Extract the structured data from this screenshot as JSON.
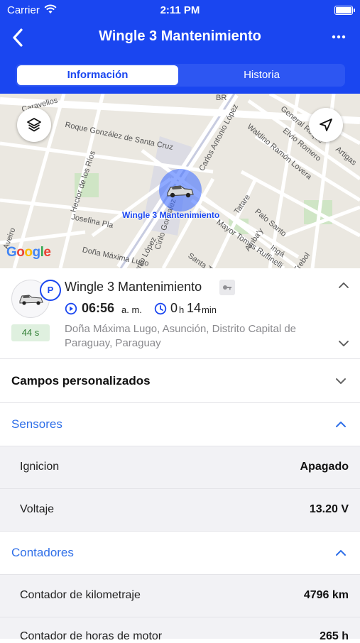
{
  "status": {
    "carrier": "Carrier",
    "time": "2:11 PM"
  },
  "nav": {
    "title": "Wingle 3 Mantenimiento"
  },
  "tabs": [
    {
      "label": "Información"
    },
    {
      "label": "Historia"
    }
  ],
  "map": {
    "marker_label": "Wingle 3 Mantenimiento",
    "google": "Google",
    "streets": [
      "Roque González de Santa Cruz",
      "Carlos Antonio López",
      "Doña Máxima Lugo",
      "Josefina Pla",
      "Hector de los Ríos",
      "Cirilo Gonzalez",
      "Waldino Ramón Lovera",
      "Elvio Romero",
      "General Roque",
      "Artigas",
      "Mayor Tomas Ruffinelli",
      "Santa Teresa",
      "Amba'y",
      "Ingá",
      "Trebol",
      "Palo Santo",
      "Antonio López",
      "Caravellos",
      "Aveiro",
      "Tatare",
      "BR"
    ]
  },
  "vehicle": {
    "name": "Wingle 3 Mantenimiento",
    "parking_badge": "P",
    "age": "44 s",
    "time": "06:56",
    "time_suffix": "a. m.",
    "duration_h": "0",
    "duration_h_unit": "h",
    "duration_m": "14",
    "duration_m_unit": "min",
    "address": "Doña Máxima Lugo, Asunción, Distrito Capital de Paraguay, Paraguay"
  },
  "sections": {
    "custom_fields": "Campos personalizados",
    "sensors": "Sensores",
    "counters": "Contadores"
  },
  "sensors": [
    {
      "label": "Ignicion",
      "value": "Apagado"
    },
    {
      "label": "Voltaje",
      "value": "13.20 V"
    }
  ],
  "counters": [
    {
      "label": "Contador de kilometraje",
      "value": "4796 km"
    },
    {
      "label": "Contador de horas de motor",
      "value": "265 h"
    }
  ],
  "colors": {
    "primary": "#1a46f0",
    "accent_text": "#2f6fe8",
    "badge_green": "#dff0df"
  }
}
